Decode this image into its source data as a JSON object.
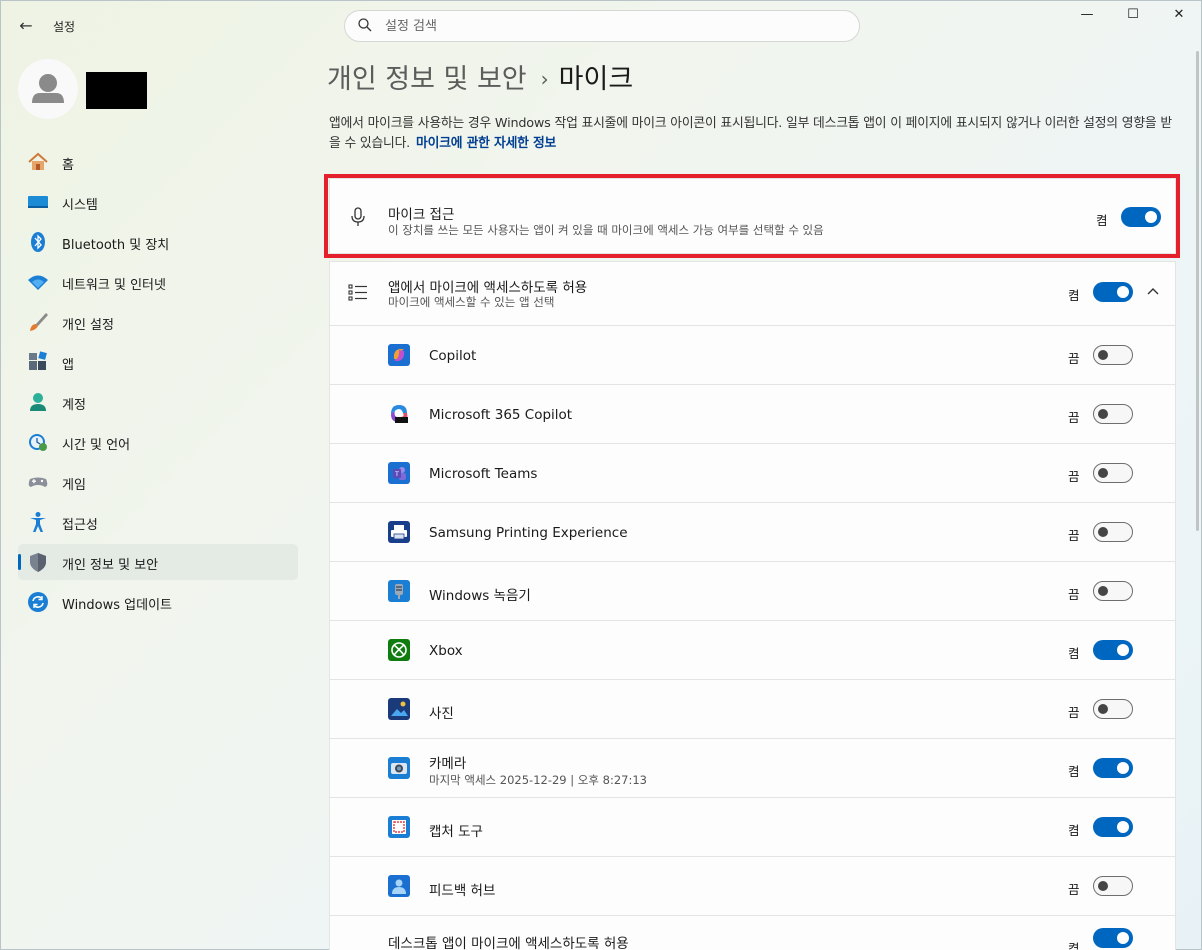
{
  "window": {
    "title": "설정",
    "back_glyph": "←",
    "minimize_glyph": "—",
    "maximize_glyph": "☐",
    "close_glyph": "✕"
  },
  "search": {
    "placeholder": "설정 검색"
  },
  "sidebar": {
    "items": [
      {
        "label": "홈",
        "icon": "home-icon"
      },
      {
        "label": "시스템",
        "icon": "system-icon"
      },
      {
        "label": "Bluetooth 및 장치",
        "icon": "bluetooth-icon"
      },
      {
        "label": "네트워크 및 인터넷",
        "icon": "wifi-icon"
      },
      {
        "label": "개인 설정",
        "icon": "brush-icon"
      },
      {
        "label": "앱",
        "icon": "apps-icon"
      },
      {
        "label": "계정",
        "icon": "account-icon"
      },
      {
        "label": "시간 및 언어",
        "icon": "clock-globe-icon"
      },
      {
        "label": "게임",
        "icon": "gamepad-icon"
      },
      {
        "label": "접근성",
        "icon": "accessibility-icon"
      },
      {
        "label": "개인 정보 및 보안",
        "icon": "shield-icon",
        "active": true
      },
      {
        "label": "Windows 업데이트",
        "icon": "update-icon"
      }
    ]
  },
  "breadcrumb": {
    "parent": "개인 정보 및 보안",
    "separator": "›",
    "current": "마이크"
  },
  "description": {
    "text": "앱에서 마이크를 사용하는 경우 Windows 작업 표시줄에 마이크 아이콘이 표시됩니다. 일부 데스크톱 앱이 이 페이지에 표시되지 않거나 이러한 설정의 영향을 받을 수 있습니다.",
    "link": "마이크에 관한 자세한 정보"
  },
  "mic_access": {
    "title": "마이크 접근",
    "subtitle": "이 장치를 쓰는 모든 사용자는 앱이 켜 있을 때 마이크에 액세스 가능 여부를 선택할 수 있음",
    "state": "켬",
    "on": true
  },
  "app_access": {
    "title": "앱에서 마이크에 액세스하도록 허용",
    "subtitle": "마이크에 액세스할 수 있는 앱 선택",
    "state": "켬",
    "on": true
  },
  "apps": [
    {
      "name": "Copilot",
      "state": "끔",
      "on": false,
      "icon": "copilot-icon"
    },
    {
      "name": "Microsoft 365 Copilot",
      "state": "끔",
      "on": false,
      "icon": "m365-copilot-icon"
    },
    {
      "name": "Microsoft Teams",
      "state": "끔",
      "on": false,
      "icon": "teams-icon"
    },
    {
      "name": "Samsung Printing Experience",
      "state": "끔",
      "on": false,
      "icon": "printer-icon"
    },
    {
      "name": "Windows 녹음기",
      "state": "끔",
      "on": false,
      "icon": "recorder-icon"
    },
    {
      "name": "Xbox",
      "state": "켬",
      "on": true,
      "icon": "xbox-icon"
    },
    {
      "name": "사진",
      "state": "끔",
      "on": false,
      "icon": "photos-icon"
    },
    {
      "name": "카메라",
      "sub": "마지막 액세스 2025-12-29 | 오후 8:27:13",
      "state": "켬",
      "on": true,
      "icon": "camera-icon"
    },
    {
      "name": "캡처 도구",
      "state": "켬",
      "on": true,
      "icon": "snipping-tool-icon"
    },
    {
      "name": "피드백 허브",
      "state": "끔",
      "on": false,
      "icon": "feedback-hub-icon"
    }
  ],
  "desktop_apps": {
    "title": "데스크톱 앱이 마이크에 액세스하도록 허용",
    "state": "켬",
    "on": true
  },
  "colors": {
    "accent": "#0067c0",
    "highlight_border": "#e3202c",
    "link": "#003e92"
  }
}
